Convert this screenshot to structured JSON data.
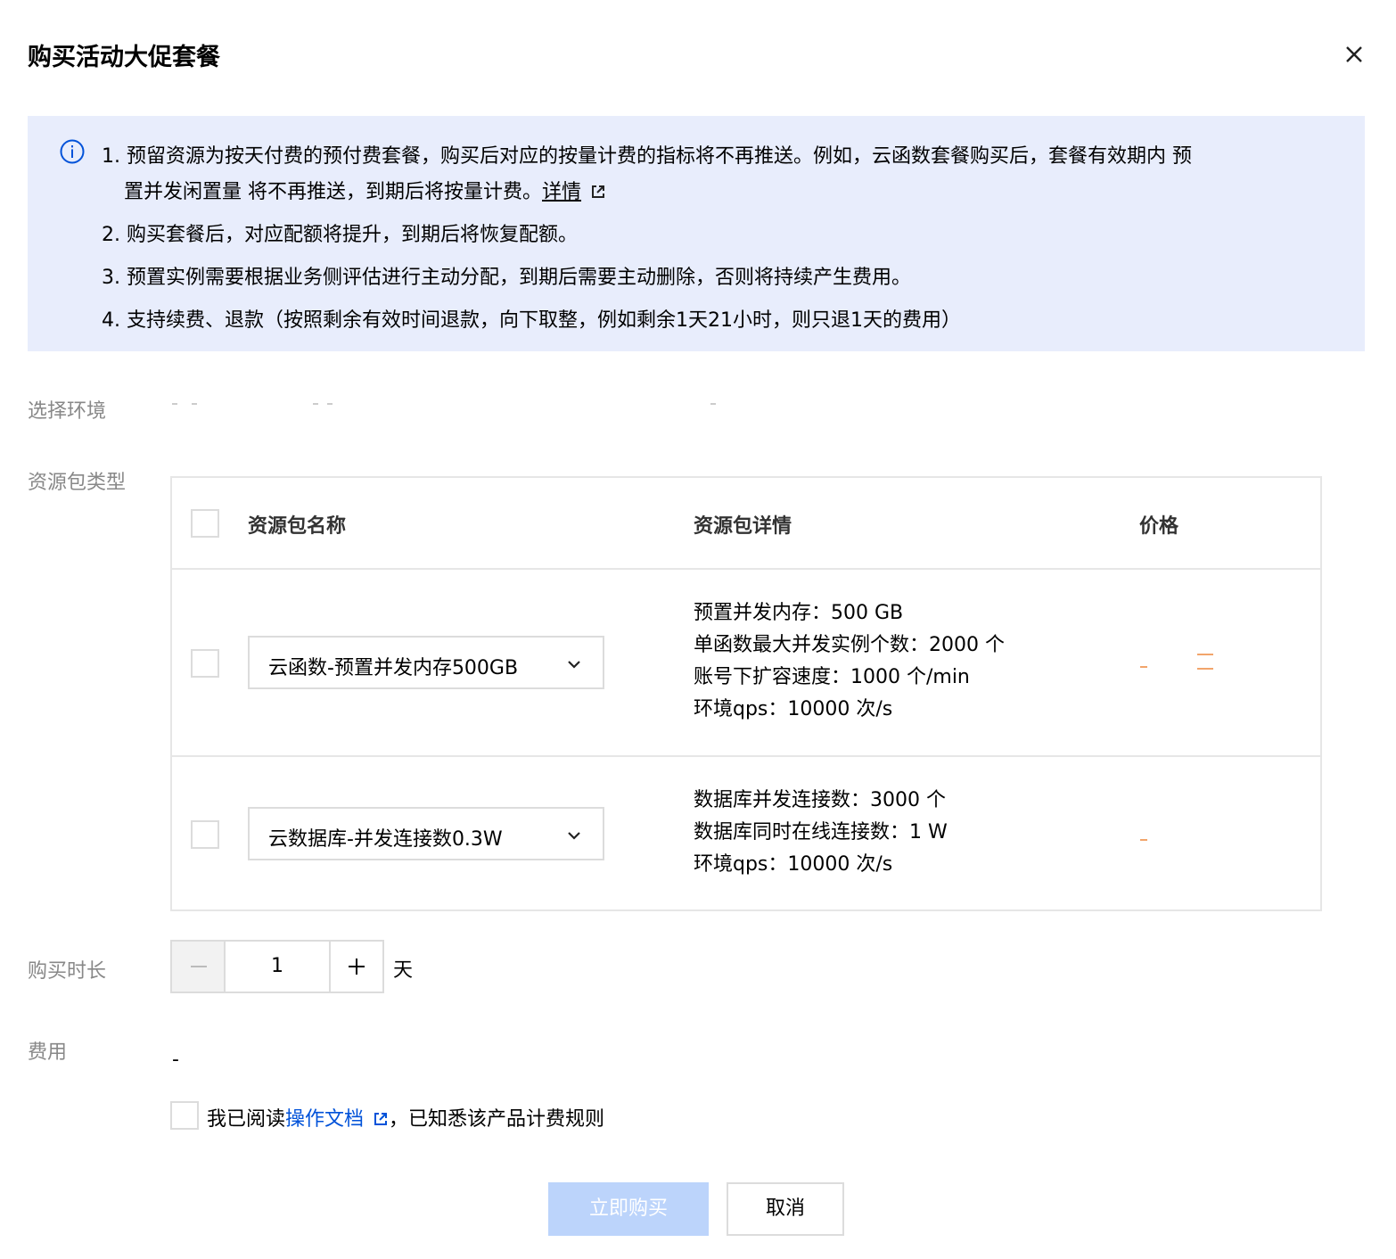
{
  "dialog": {
    "title": "购买活动大促套餐",
    "close_icon": "close-icon"
  },
  "notice": {
    "icon": "info-circle-icon",
    "line1": "1. 预留资源为按天付费的预付费套餐，购买后对应的按量计费的指标将不再推送。例如，云函数套餐购买后，套餐有效期内 预",
    "line2_prefix": "置并发闲置量 将不再推送，到期后将按量计费。",
    "line2_link": "详情",
    "line3": "2. 购买套餐后，对应配额将提升，到期后将恢复配额。",
    "line4": "3. 预置实例需要根据业务侧评估进行主动分配，到期后需要主动删除，否则将持续产生费用。",
    "line5": "4. 支持续费、退款（按照剩余有效时间退款，向下取整，例如剩余1天21小时，则只退1天的费用）"
  },
  "form": {
    "env_label": "选择环境",
    "pkg_label": "资源包类型",
    "duration_label": "购买时长",
    "fee_label": "费用"
  },
  "table": {
    "headers": [
      "资源包名称",
      "资源包详情",
      "价格"
    ],
    "rows": [
      {
        "select_value": "云函数-预置并发内存500GB",
        "details": [
          "预置并发内存：500 GB",
          "单函数最大并发实例个数：2000 个",
          "账号下扩容速度：1000 个/min",
          "环境qps：10000 次/s"
        ]
      },
      {
        "select_value": "云数据库-并发连接数0.3W",
        "details": [
          "数据库并发连接数：3000 个",
          "数据库同时在线连接数：1 W",
          "环境qps：10000 次/s"
        ]
      }
    ]
  },
  "duration": {
    "value": "1",
    "unit": "天"
  },
  "fee": {
    "value": "-"
  },
  "agreement": {
    "prefix": "我已阅读",
    "link": "操作文档",
    "suffix": "，已知悉该产品计费规则"
  },
  "buttons": {
    "buy": "立即购买",
    "cancel": "取消"
  },
  "colors": {
    "notice_bg": "#e8edfc",
    "link": "#0052d9",
    "buy_disabled": "#bcd4fb"
  }
}
